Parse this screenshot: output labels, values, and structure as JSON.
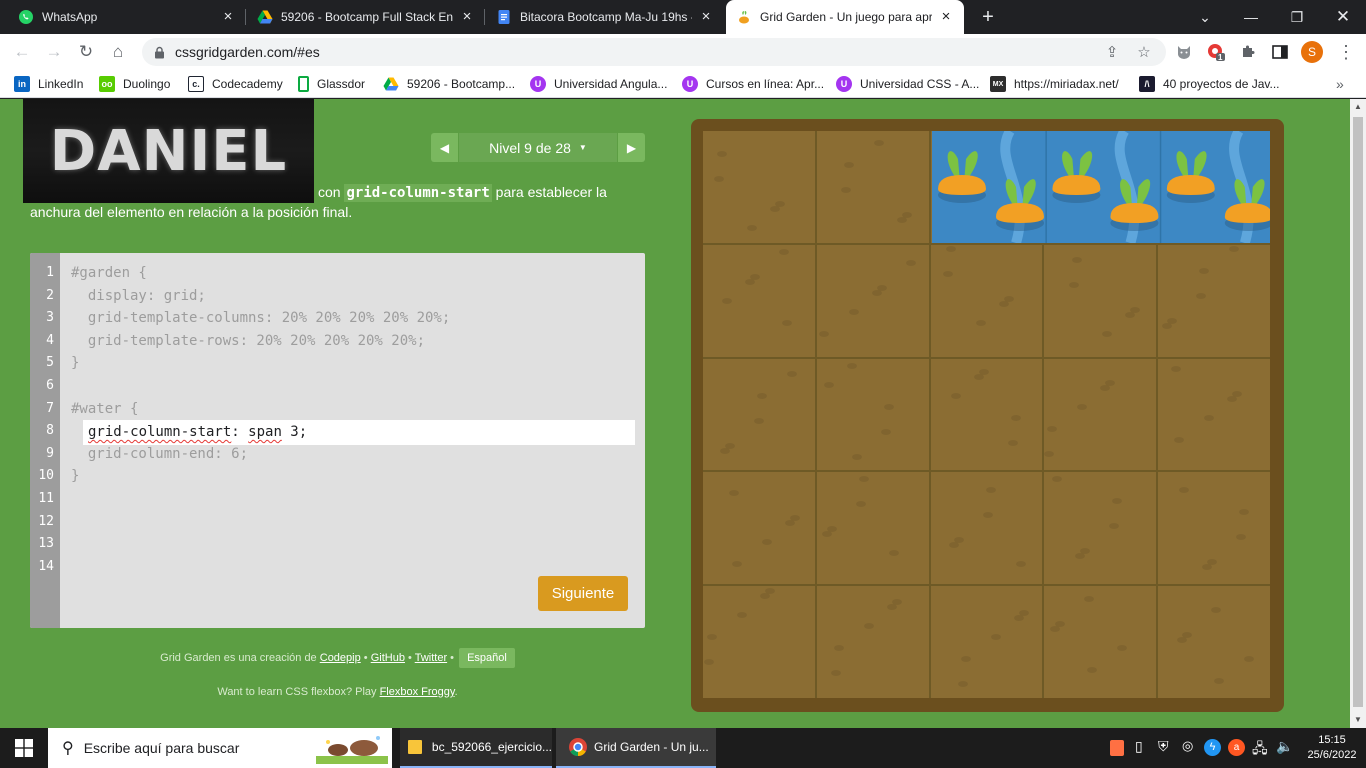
{
  "browser": {
    "tabs": [
      {
        "title": "WhatsApp",
        "active": false
      },
      {
        "title": "59206 - Bootcamp Full Stack Eng",
        "active": false
      },
      {
        "title": "Bitacora Bootcamp Ma-Ju 19hs -",
        "active": false
      },
      {
        "title": "Grid Garden - Un juego para apre",
        "active": true
      }
    ],
    "url": "cssgridgarden.com/#es",
    "profile_initial": "S",
    "extension_badge": "1",
    "bookmarks": [
      "LinkedIn",
      "Duolingo",
      "Codecademy",
      "Glassdor",
      "59206 - Bootcamp...",
      "Universidad Angula...",
      "Cursos en línea: Apr...",
      "Universidad CSS - A...",
      "https://miriadax.net/",
      "40 proyectos de Jav..."
    ]
  },
  "page": {
    "overlay_text": "DANIEL",
    "level": {
      "label": "Nivel 9 de 28"
    },
    "instructions": {
      "prefix": "con",
      "code": "grid-column-start",
      "line1_suffix": "para establecer la",
      "line2": "anchura del elemento en relación a la posición final."
    },
    "editor": {
      "line_numbers": [
        "1",
        "2",
        "3",
        "4",
        "5",
        "6",
        "7",
        "8",
        "9",
        "10",
        "11",
        "12",
        "13",
        "14"
      ],
      "lines": [
        "#garden {",
        "  display: grid;",
        "  grid-template-columns: 20% 20% 20% 20% 20%;",
        "  grid-template-rows: 20% 20% 20% 20% 20%;",
        "}",
        "",
        "#water {",
        "",
        "  grid-column-end: 6;",
        "}"
      ],
      "input_property": "grid-column-start",
      "input_rest": ": ",
      "input_value_keyword": "span",
      "input_value_rest": " 3;",
      "next_button": "Siguiente"
    },
    "footer": {
      "credit_prefix": "Grid Garden es una creación de",
      "codepip": "Codepip",
      "github": "GitHub",
      "twitter": "Twitter",
      "language": "Español",
      "flexbox_prefix": "Want to learn CSS flexbox? Play",
      "flexbox_link": "Flexbox Froggy",
      "flexbox_suffix": "."
    },
    "garden": {
      "columns": 5,
      "rows": 5,
      "water_columns": 3
    }
  },
  "taskbar": {
    "search_placeholder": "Escribe aquí para buscar",
    "apps": [
      {
        "label": "bc_592066_ejercicio...",
        "icon": "folder-icon"
      },
      {
        "label": "Grid Garden - Un ju...",
        "icon": "chrome-icon"
      }
    ],
    "time": "15:15",
    "date": "25/6/2022"
  },
  "colors": {
    "page_bg": "#5c9e43",
    "garden_soil": "#8b6d33",
    "water": "#3d88c4",
    "button": "#d99a1f"
  }
}
